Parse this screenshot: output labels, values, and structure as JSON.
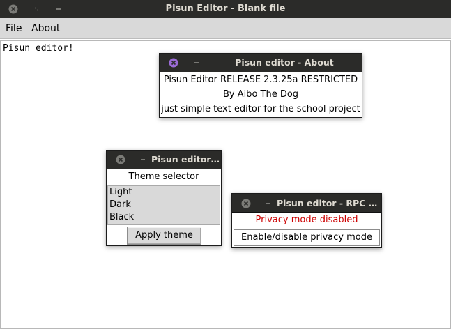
{
  "window": {
    "title": "Pisun Editor - Blank file"
  },
  "menubar": {
    "items": [
      "File",
      "About"
    ]
  },
  "editor": {
    "content": "Pisun editor!"
  },
  "about_dialog": {
    "title": "Pisun editor - About",
    "lines": [
      "Pisun Editor RELEASE 2.3.25a RESTRICTED",
      "By Aibo The Dog",
      "just simple text editor for the school project"
    ]
  },
  "theme_dialog": {
    "title": "Pisun editor ...",
    "heading": "Theme selector",
    "options": [
      "Light",
      "Dark",
      "Black"
    ],
    "apply_label": "Apply theme"
  },
  "rpc_dialog": {
    "title": "Pisun editor - RPC Pr...",
    "status": "Privacy mode disabled",
    "toggle_label": "Enable/disable privacy mode"
  },
  "colors": {
    "titlebar_bg": "#2b2b29",
    "close_accent": "#9b6bd6",
    "status_red": "#cc0000",
    "menubar_bg": "#d9d9d9"
  }
}
